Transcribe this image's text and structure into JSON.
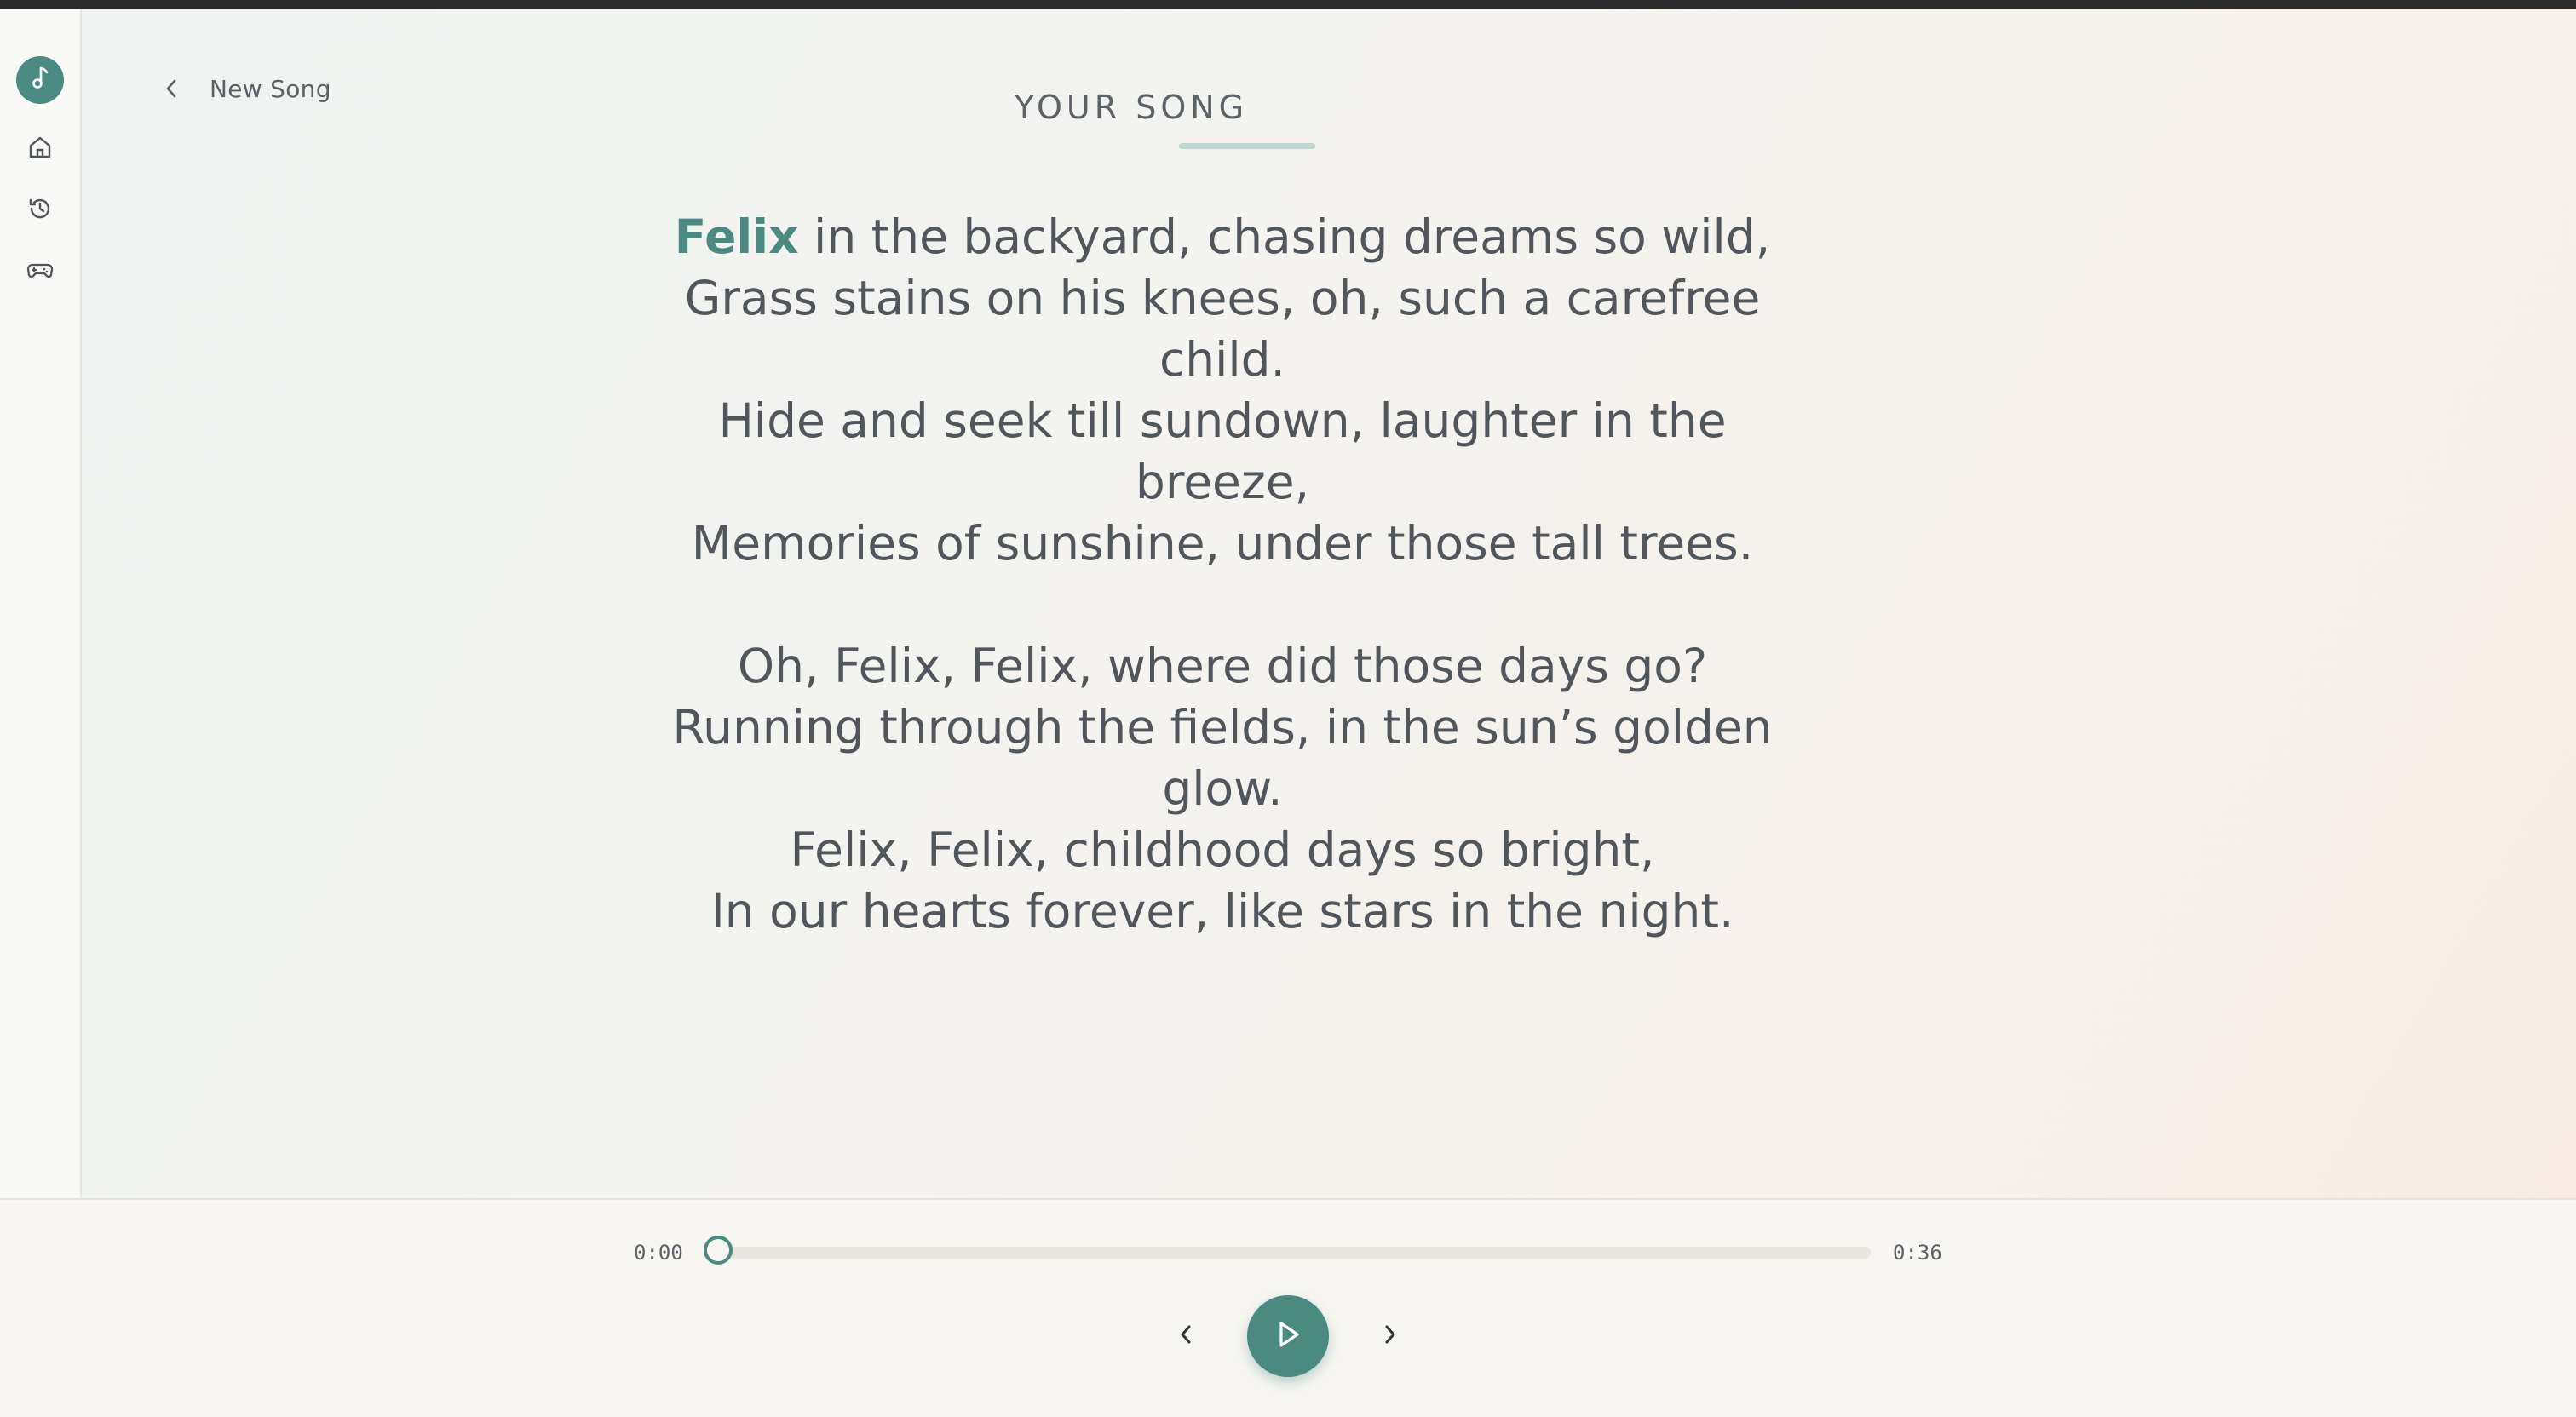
{
  "app": {
    "logo_icon": "music-note-icon",
    "accent_color": "#4a8a80"
  },
  "sidebar": {
    "items": [
      {
        "name": "home",
        "icon": "home-icon"
      },
      {
        "name": "history",
        "icon": "history-icon"
      },
      {
        "name": "games",
        "icon": "gamepad-icon"
      }
    ]
  },
  "header": {
    "back_label": "New Song",
    "title": "YOUR SONG"
  },
  "lyrics": {
    "highlight_word": "Felix",
    "stanza1": {
      "line1_rest": " in the backyard, chasing dreams so wild,",
      "line2": "Grass stains on his knees, oh, such a carefree child.",
      "line3": "Hide and seek till sundown, laughter in the breeze,",
      "line4": "Memories of sunshine, under those tall trees."
    },
    "stanza2": {
      "line1": "Oh, Felix, Felix, where did those days go?",
      "line2": "Running through the fields, in the sun’s golden glow.",
      "line3": "Felix, Felix, childhood days so bright,",
      "line4": "In our hearts forever, like stars in the night."
    }
  },
  "player": {
    "current_time": "0:00",
    "total_time": "0:36",
    "progress": 0
  }
}
